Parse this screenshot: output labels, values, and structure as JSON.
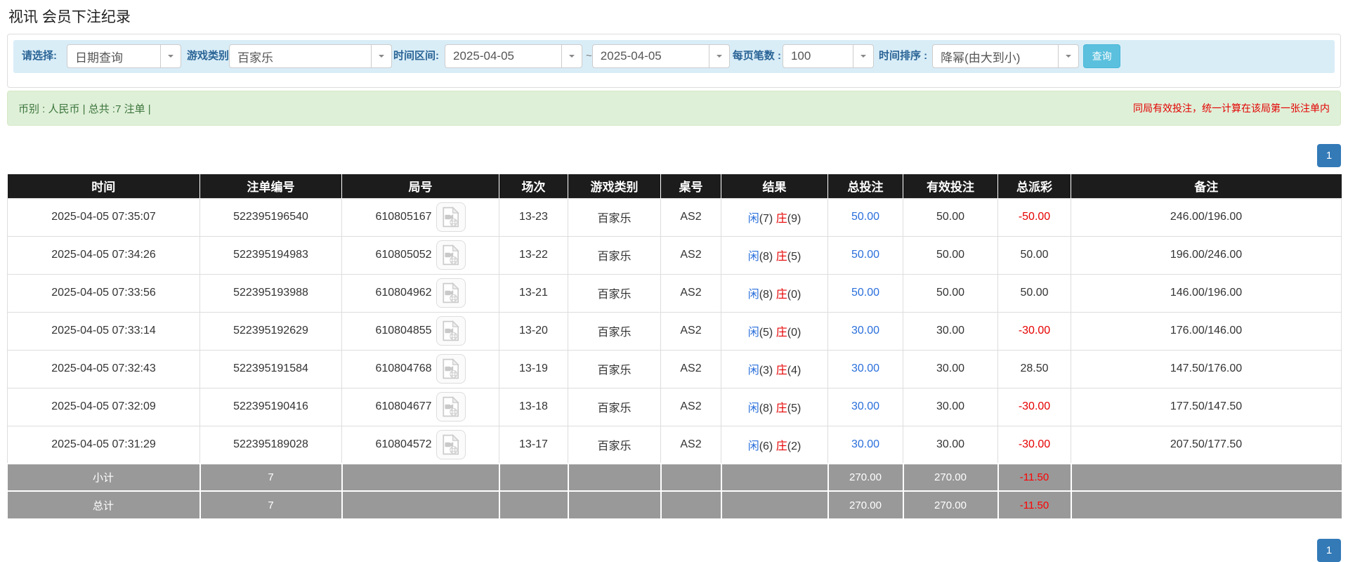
{
  "page": {
    "title": "视讯 会员下注纪录"
  },
  "filters": {
    "select_label": "请选择:",
    "select_value": "日期查询",
    "game_type_label": "游戏类别",
    "game_type_value": "百家乐",
    "date_range_label": "时间区间:",
    "date_from": "2025-04-05",
    "range_separator": "~",
    "date_to": "2025-04-05",
    "page_size_label": "每页笔数 :",
    "page_size_value": "100",
    "sort_label": "时间排序 :",
    "sort_value": "降幂(由大到小)",
    "search_button": "查询"
  },
  "summary": {
    "left_text": "币别 : 人民币 | 总共 :7 注单 |",
    "right_notice": "同局有效投注，统一计算在该局第一张注单内"
  },
  "pagination": {
    "page": "1"
  },
  "table": {
    "headers": [
      "时间",
      "注单编号",
      "局号",
      "场次",
      "游戏类别",
      "桌号",
      "结果",
      "总投注",
      "有效投注",
      "总派彩",
      "备注"
    ],
    "rows": [
      {
        "time": "2025-04-05 07:35:07",
        "bet_id": "522395196540",
        "round_id": "610805167",
        "session": "13-23",
        "game": "百家乐",
        "table_no": "AS2",
        "player_label": "闲",
        "player_score": "(7)",
        "banker_label": "庄",
        "banker_score": "(9)",
        "total_bet": "50.00",
        "valid_bet": "50.00",
        "payout": "-50.00",
        "remark": "246.00/196.00"
      },
      {
        "time": "2025-04-05 07:34:26",
        "bet_id": "522395194983",
        "round_id": "610805052",
        "session": "13-22",
        "game": "百家乐",
        "table_no": "AS2",
        "player_label": "闲",
        "player_score": "(8)",
        "banker_label": "庄",
        "banker_score": "(5)",
        "total_bet": "50.00",
        "valid_bet": "50.00",
        "payout": "50.00",
        "remark": "196.00/246.00"
      },
      {
        "time": "2025-04-05 07:33:56",
        "bet_id": "522395193988",
        "round_id": "610804962",
        "session": "13-21",
        "game": "百家乐",
        "table_no": "AS2",
        "player_label": "闲",
        "player_score": "(8)",
        "banker_label": "庄",
        "banker_score": "(0)",
        "total_bet": "50.00",
        "valid_bet": "50.00",
        "payout": "50.00",
        "remark": "146.00/196.00"
      },
      {
        "time": "2025-04-05 07:33:14",
        "bet_id": "522395192629",
        "round_id": "610804855",
        "session": "13-20",
        "game": "百家乐",
        "table_no": "AS2",
        "player_label": "闲",
        "player_score": "(5)",
        "banker_label": "庄",
        "banker_score": "(0)",
        "total_bet": "30.00",
        "valid_bet": "30.00",
        "payout": "-30.00",
        "remark": "176.00/146.00"
      },
      {
        "time": "2025-04-05 07:32:43",
        "bet_id": "522395191584",
        "round_id": "610804768",
        "session": "13-19",
        "game": "百家乐",
        "table_no": "AS2",
        "player_label": "闲",
        "player_score": "(3)",
        "banker_label": "庄",
        "banker_score": "(4)",
        "total_bet": "30.00",
        "valid_bet": "30.00",
        "payout": "28.50",
        "remark": "147.50/176.00"
      },
      {
        "time": "2025-04-05 07:32:09",
        "bet_id": "522395190416",
        "round_id": "610804677",
        "session": "13-18",
        "game": "百家乐",
        "table_no": "AS2",
        "player_label": "闲",
        "player_score": "(8)",
        "banker_label": "庄",
        "banker_score": "(5)",
        "total_bet": "30.00",
        "valid_bet": "30.00",
        "payout": "-30.00",
        "remark": "177.50/147.50"
      },
      {
        "time": "2025-04-05 07:31:29",
        "bet_id": "522395189028",
        "round_id": "610804572",
        "session": "13-17",
        "game": "百家乐",
        "table_no": "AS2",
        "player_label": "闲",
        "player_score": "(6)",
        "banker_label": "庄",
        "banker_score": "(2)",
        "total_bet": "30.00",
        "valid_bet": "30.00",
        "payout": "-30.00",
        "remark": "207.50/177.50"
      }
    ],
    "subtotal": {
      "label": "小计",
      "count": "7",
      "total_bet": "270.00",
      "valid_bet": "270.00",
      "payout": "-11.50"
    },
    "total": {
      "label": "总计",
      "count": "7",
      "total_bet": "270.00",
      "valid_bet": "270.00",
      "payout": "-11.50"
    }
  }
}
